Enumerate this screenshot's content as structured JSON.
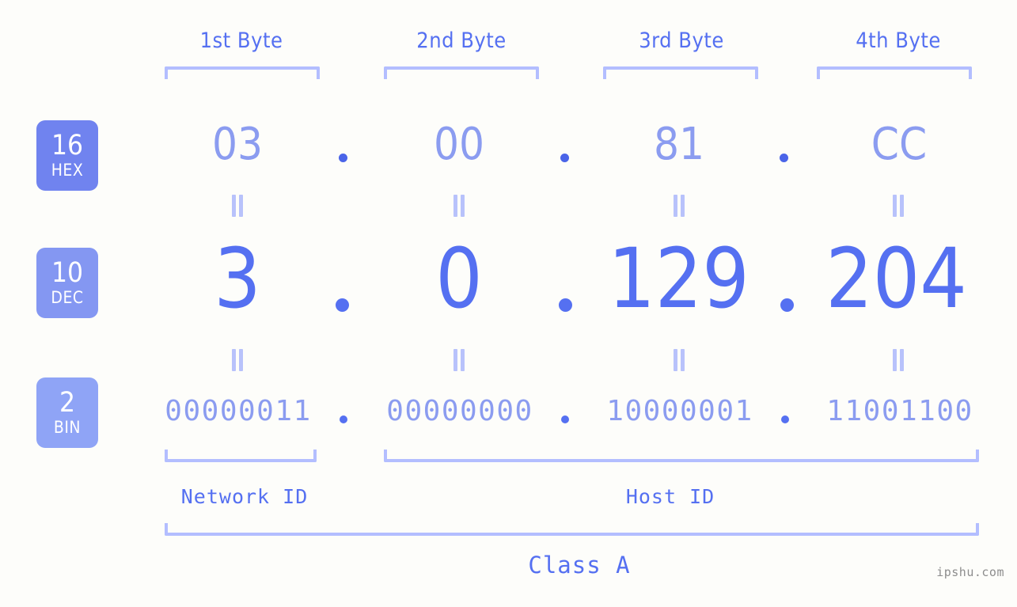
{
  "background_color": "#fdfdfa",
  "accent_color": "#5570f1",
  "light_accent_color": "#8b9cf0",
  "bracket_color": "#b3beff",
  "headers": [
    {
      "label": "1st Byte"
    },
    {
      "label": "2nd Byte"
    },
    {
      "label": "3rd Byte"
    },
    {
      "label": "4th Byte"
    }
  ],
  "rows": {
    "hex": {
      "badge_number": "16",
      "badge_name": "HEX",
      "badge_color": "#7083ef",
      "values": [
        "03",
        "00",
        "81",
        "CC"
      ],
      "separator": "."
    },
    "dec": {
      "badge_number": "10",
      "badge_name": "DEC",
      "badge_color": "#8497f2",
      "values": [
        "3",
        "0",
        "129",
        "204"
      ],
      "separator": "."
    },
    "bin": {
      "badge_number": "2",
      "badge_name": "BIN",
      "badge_color": "#8fa4f6",
      "values": [
        "00000011",
        "00000000",
        "10000001",
        "11001100"
      ],
      "separator": "."
    }
  },
  "equals_symbol": "=",
  "segments": {
    "network_id": "Network ID",
    "host_id": "Host ID",
    "class": "Class A"
  },
  "watermark": "ipshu.com"
}
